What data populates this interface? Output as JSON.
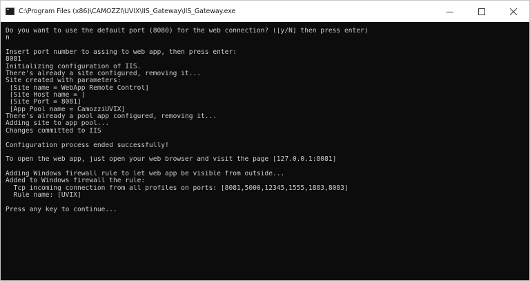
{
  "window": {
    "title": "C:\\Program Files (x86)\\CAMOZZI\\UVIX\\IIS_Gateway\\IIS_Gateway.exe",
    "icon": "console-app-icon",
    "controls": {
      "minimize": "minimize-icon",
      "maximize": "maximize-icon",
      "close": "close-icon"
    }
  },
  "console": {
    "lines": [
      "Do you want to use the default port (8080) for the web connection? ([y/N] then press enter)",
      "n",
      "",
      "Insert port number to assing to web app, then press enter:",
      "8081",
      "Initializing configuration of IIS.",
      "There's already a site configured, removing it...",
      "Site created with parameters:",
      " [Site name = WebApp Remote Control]",
      " [Site Host name = ]",
      " [Site Port = 8081]",
      " [App Pool name = CamozziUVIX]",
      "There's already a pool app configured, removing it...",
      "Adding site to app pool...",
      "Changes committed to IIS",
      "",
      "Configuration process ended successfully!",
      "",
      "To open the web app, just open your web browser and visit the page [127.0.0.1:8081]",
      "",
      "Adding Windows firewall rule to let web app be visible from outside...",
      "Added to Windows firewall the rule:",
      "  Tcp incoming connection from all profiles on ports: [8081,5000,12345,1555,1883,8083]",
      "  Rule name: [UVIX]",
      "",
      "Press any key to continue..."
    ]
  },
  "colors": {
    "console_bg": "#0c0c0c",
    "console_text": "#cccccc",
    "titlebar_bg": "#ffffff"
  }
}
